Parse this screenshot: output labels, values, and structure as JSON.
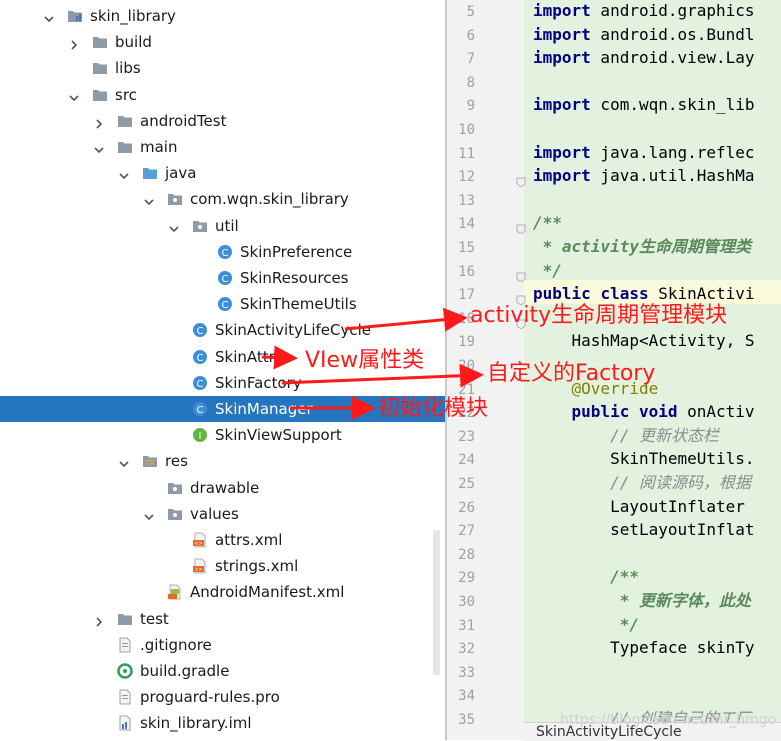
{
  "project_tree": {
    "items": [
      {
        "label": "skin_library",
        "icon": "module-folder-icon",
        "expander": "expanded"
      },
      {
        "label": "build",
        "icon": "folder-icon",
        "expander": "collapsed"
      },
      {
        "label": "libs",
        "icon": "folder-icon",
        "expander": "none"
      },
      {
        "label": "src",
        "icon": "folder-icon",
        "expander": "expanded"
      },
      {
        "label": "androidTest",
        "icon": "folder-icon",
        "expander": "collapsed"
      },
      {
        "label": "main",
        "icon": "folder-icon",
        "expander": "expanded"
      },
      {
        "label": "java",
        "icon": "source-folder-icon",
        "expander": "expanded"
      },
      {
        "label": "com.wqn.skin_library",
        "icon": "package-icon",
        "expander": "expanded"
      },
      {
        "label": "util",
        "icon": "package-icon",
        "expander": "expanded"
      },
      {
        "label": "SkinPreference",
        "icon": "class-icon",
        "expander": "none"
      },
      {
        "label": "SkinResources",
        "icon": "class-icon",
        "expander": "none"
      },
      {
        "label": "SkinThemeUtils",
        "icon": "class-icon",
        "expander": "none"
      },
      {
        "label": "SkinActivityLifeCycle",
        "icon": "class-icon",
        "expander": "none"
      },
      {
        "label": "SkinAttr",
        "icon": "class-icon",
        "expander": "none"
      },
      {
        "label": "SkinFactory",
        "icon": "class-icon",
        "expander": "none"
      },
      {
        "label": "SkinManager",
        "icon": "class-icon",
        "expander": "none",
        "selected": true
      },
      {
        "label": "SkinViewSupport",
        "icon": "interface-icon",
        "expander": "none"
      },
      {
        "label": "res",
        "icon": "resource-folder-icon",
        "expander": "expanded"
      },
      {
        "label": "drawable",
        "icon": "package-icon",
        "expander": "none"
      },
      {
        "label": "values",
        "icon": "package-icon",
        "expander": "expanded"
      },
      {
        "label": "attrs.xml",
        "icon": "xml-file-icon",
        "expander": "none"
      },
      {
        "label": "strings.xml",
        "icon": "xml-file-icon",
        "expander": "none"
      },
      {
        "label": "AndroidManifest.xml",
        "icon": "manifest-file-icon",
        "expander": "none"
      },
      {
        "label": "test",
        "icon": "folder-icon",
        "expander": "collapsed"
      },
      {
        "label": ".gitignore",
        "icon": "text-file-icon",
        "expander": "none"
      },
      {
        "label": "build.gradle",
        "icon": "gradle-file-icon",
        "expander": "none"
      },
      {
        "label": "proguard-rules.pro",
        "icon": "text-file-icon",
        "expander": "none"
      },
      {
        "label": "skin_library.iml",
        "icon": "iml-file-icon",
        "expander": "none"
      }
    ]
  },
  "editor": {
    "line_numbers": [
      "5",
      "6",
      "7",
      "8",
      "9",
      "10",
      "11",
      "12",
      "13",
      "14",
      "15",
      "16",
      "17",
      "18",
      "19",
      "20",
      "21",
      "22",
      "23",
      "24",
      "25",
      "26",
      "27",
      "28",
      "29",
      "30",
      "31",
      "32",
      "33",
      "34",
      "35"
    ],
    "code_lines": [
      {
        "n": "5",
        "text": "import android.graphics"
      },
      {
        "n": "6",
        "text": "import android.os.Bundl"
      },
      {
        "n": "7",
        "text": "import android.view.Lay"
      },
      {
        "n": "8",
        "text": ""
      },
      {
        "n": "9",
        "text": "import com.wqn.skin_lib"
      },
      {
        "n": "10",
        "text": ""
      },
      {
        "n": "11",
        "text": "import java.lang.reflec"
      },
      {
        "n": "12",
        "text": "import java.util.HashMa"
      },
      {
        "n": "13",
        "text": ""
      },
      {
        "n": "14",
        "text": "/**"
      },
      {
        "n": "15",
        "text": " * activity生命周期管理类"
      },
      {
        "n": "16",
        "text": " */"
      },
      {
        "n": "17",
        "text": "public class SkinActivi"
      },
      {
        "n": "18",
        "text": ""
      },
      {
        "n": "19",
        "text": "    HashMap<Activity, S"
      },
      {
        "n": "20",
        "text": ""
      },
      {
        "n": "21",
        "text": "    @Override"
      },
      {
        "n": "22",
        "text": "    public void onActiv"
      },
      {
        "n": "23",
        "text": "        // 更新状态栏"
      },
      {
        "n": "24",
        "text": "        SkinThemeUtils."
      },
      {
        "n": "25",
        "text": "        // 阅读源码，根据"
      },
      {
        "n": "26",
        "text": "        LayoutInflater "
      },
      {
        "n": "27",
        "text": "        setLayoutInflat"
      },
      {
        "n": "28",
        "text": ""
      },
      {
        "n": "29",
        "text": "        /**"
      },
      {
        "n": "30",
        "text": "         * 更新字体，此处"
      },
      {
        "n": "31",
        "text": "         */"
      },
      {
        "n": "32",
        "text": "        Typeface skinTy"
      },
      {
        "n": "33",
        "text": ""
      },
      {
        "n": "34",
        "text": ""
      },
      {
        "n": "35",
        "text": "        // 创建自己的工厂"
      }
    ],
    "status_tab": "SkinActivityLifeCycle",
    "watermark": "https://blog.csdn.net/mr_hmgo"
  },
  "annotations": [
    {
      "text": "activity生命周期管理模块",
      "target": "SkinActivityLifeCycle"
    },
    {
      "text": "VIew属性类",
      "target": "SkinAttr"
    },
    {
      "text": "自定义的Factory",
      "target": "SkinFactory"
    },
    {
      "text": "初始化模块",
      "target": "SkinManager"
    }
  ],
  "colors": {
    "selection": "#2675bf",
    "annotation": "#ff1a1a",
    "editor_background": "#e2f2df",
    "keyword": "#000080"
  }
}
